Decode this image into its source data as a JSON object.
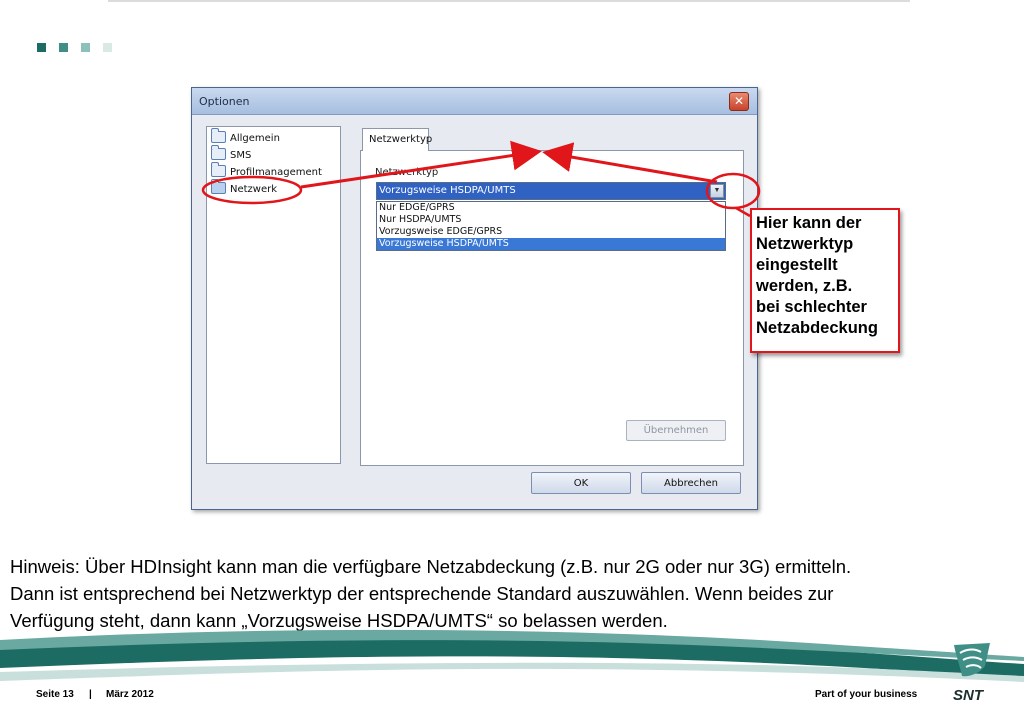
{
  "slide": {
    "accent_colors": [
      "#1c6c63",
      "#3f8f86",
      "#8cc0ba",
      "#d8e9e6"
    ]
  },
  "dialog": {
    "title": "Optionen",
    "close_symbol": "✕",
    "tree": [
      {
        "label": "Allgemein",
        "icon": "folder-icon"
      },
      {
        "label": "SMS",
        "icon": "folder-icon"
      },
      {
        "label": "Profilmanagement",
        "icon": "folder-icon"
      },
      {
        "label": "Netzwerk",
        "icon": "folder-open-icon"
      }
    ],
    "tab_label": "Netzwerktyp",
    "field_label": "Netzwerktyp",
    "combo_value": "Vorzugsweise HSDPA/UMTS",
    "combo_arrow": "▼",
    "options": [
      {
        "label": "Nur EDGE/GPRS",
        "selected": false
      },
      {
        "label": "Nur HSDPA/UMTS",
        "selected": false
      },
      {
        "label": "Vorzugsweise EDGE/GPRS",
        "selected": false
      },
      {
        "label": "Vorzugsweise HSDPA/UMTS",
        "selected": true
      }
    ],
    "apply_label": "Übernehmen",
    "ok_label": "OK",
    "cancel_label": "Abbrechen"
  },
  "callout": {
    "text": "Hier kann der\nNetzwerktyp\neingestellt\nwerden, z.B.\nbei schlechter\nNetzabdeckung",
    "color": "#e0161b"
  },
  "hint": {
    "line1": "Hinweis: Über HDInsight kann man die verfügbare Netzabdeckung (z.B. nur 2G oder nur 3G) ermitteln.",
    "line2": "Dann ist entsprechend bei Netzwerktyp der entsprechende Standard auszuwählen. Wenn beides zur",
    "line3": "Verfügung steht, dann kann „Vorzugsweise HSDPA/UMTS“ so belassen werden."
  },
  "footer": {
    "page": "Seite 13",
    "separator": "|",
    "date": "März 2012",
    "slogan": "Part of your business",
    "logo_text": "SNT"
  }
}
